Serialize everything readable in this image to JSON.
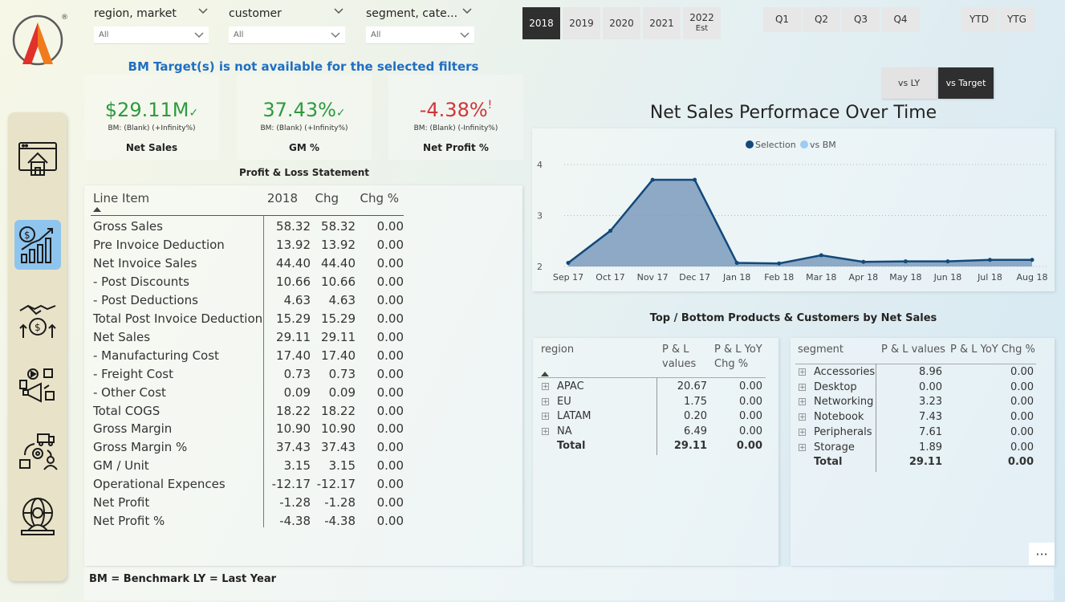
{
  "filters": [
    {
      "label": "region, market",
      "value": "All"
    },
    {
      "label": "customer",
      "value": "All"
    },
    {
      "label": "segment, cate...",
      "value": "All"
    }
  ],
  "years": [
    {
      "label": "2018",
      "active": true
    },
    {
      "label": "2019",
      "active": false
    },
    {
      "label": "2020",
      "active": false
    },
    {
      "label": "2021",
      "active": false
    },
    {
      "label": "2022",
      "sub": "Est",
      "active": false
    }
  ],
  "quarters": [
    "Q1",
    "Q2",
    "Q3",
    "Q4"
  ],
  "period": [
    "YTD",
    "YTG"
  ],
  "compare": [
    {
      "label": "vs LY",
      "active": false
    },
    {
      "label": "vs Target",
      "active": true
    }
  ],
  "banner": "BM Target(s) is not available for the selected filters",
  "kpis": [
    {
      "value": "$29.11M",
      "mark": "✓",
      "bm": "BM: (Blank) (+Infinity%)",
      "label": "Net Sales",
      "color": "#2e9a3f"
    },
    {
      "value": "37.43%",
      "mark": "✓",
      "bm": "BM: (Blank) (+Infinity%)",
      "label": "GM %",
      "color": "#2e9a3f"
    },
    {
      "value": "-4.38%",
      "mark": "!",
      "bm": "BM: (Blank) (-Infinity%)",
      "label": "Net Profit %",
      "color": "#d13438"
    }
  ],
  "pl": {
    "title": "Profit & Loss Statement",
    "headers": [
      "Line Item",
      "2018",
      "Chg",
      "Chg %"
    ],
    "rows": [
      [
        "Gross Sales",
        "58.32",
        "58.32",
        "0.00"
      ],
      [
        "Pre Invoice Deduction",
        "13.92",
        "13.92",
        "0.00"
      ],
      [
        "Net Invoice Sales",
        "44.40",
        "44.40",
        "0.00"
      ],
      [
        " - Post Discounts",
        "10.66",
        "10.66",
        "0.00"
      ],
      [
        " - Post Deductions",
        "4.63",
        "4.63",
        "0.00"
      ],
      [
        "Total Post Invoice Deduction",
        "15.29",
        "15.29",
        "0.00"
      ],
      [
        "Net Sales",
        "29.11",
        "29.11",
        "0.00"
      ],
      [
        " - Manufacturing Cost",
        "17.40",
        "17.40",
        "0.00"
      ],
      [
        " - Freight Cost",
        "0.73",
        "0.73",
        "0.00"
      ],
      [
        " - Other Cost",
        "0.09",
        "0.09",
        "0.00"
      ],
      [
        "Total COGS",
        "18.22",
        "18.22",
        "0.00"
      ],
      [
        "Gross Margin",
        "10.90",
        "10.90",
        "0.00"
      ],
      [
        "Gross Margin %",
        "37.43",
        "37.43",
        "0.00"
      ],
      [
        "GM / Unit",
        "3.15",
        "3.15",
        "0.00"
      ],
      [
        "Operational Expences",
        "-12.17",
        "-12.17",
        "0.00"
      ],
      [
        "Net Profit",
        "-1.28",
        "-1.28",
        "0.00"
      ],
      [
        "Net Profit %",
        "-4.38",
        "-4.38",
        "0.00"
      ]
    ]
  },
  "chart_data": {
    "type": "area",
    "title": "Net Sales Performace Over Time",
    "legend": [
      "Selection",
      "vs BM"
    ],
    "legend_position": "top-center",
    "colors": {
      "selection": "#12497a",
      "bm": "#9ecbf0",
      "fill": "#7b9bbd"
    },
    "categories": [
      "Sep 17",
      "Oct 17",
      "Nov 17",
      "Dec 17",
      "Jan 18",
      "Feb 18",
      "Mar 18",
      "Apr 18",
      "May 18",
      "Jun 18",
      "Jul 18",
      "Aug 18"
    ],
    "yticks": [
      "2",
      "3",
      "4"
    ],
    "ylim": [
      2,
      4
    ],
    "grid": true,
    "series": [
      {
        "name": "Selection",
        "values": [
          2.07,
          2.7,
          3.7,
          3.7,
          2.07,
          2.06,
          2.22,
          2.09,
          2.1,
          2.1,
          2.13,
          2.13
        ]
      }
    ]
  },
  "top_bottom_title": "Top / Bottom Products & Customers by Net Sales",
  "region_matrix": {
    "headers": [
      "region",
      "P & L values",
      "P & L YoY Chg %"
    ],
    "header_lines": [
      [
        "region"
      ],
      [
        "P & L",
        "values"
      ],
      [
        "P & L YoY",
        "Chg %"
      ]
    ],
    "rows": [
      [
        "APAC",
        "20.67",
        "0.00"
      ],
      [
        "EU",
        "1.75",
        "0.00"
      ],
      [
        "LATAM",
        "0.20",
        "0.00"
      ],
      [
        "NA",
        "6.49",
        "0.00"
      ]
    ],
    "total": [
      "Total",
      "29.11",
      "0.00"
    ]
  },
  "segment_matrix": {
    "headers": [
      "segment",
      "P & L values",
      "P & L YoY Chg %"
    ],
    "rows": [
      [
        "Accessories",
        "8.96",
        "0.00"
      ],
      [
        "Desktop",
        "0.00",
        "0.00"
      ],
      [
        "Networking",
        "3.23",
        "0.00"
      ],
      [
        "Notebook",
        "7.43",
        "0.00"
      ],
      [
        "Peripherals",
        "7.61",
        "0.00"
      ],
      [
        "Storage",
        "1.89",
        "0.00"
      ]
    ],
    "total": [
      "Total",
      "29.11",
      "0.00"
    ]
  },
  "footer": "BM = Benchmark LY = Last Year",
  "more_label": "···",
  "icons": {
    "logo": "atliq-logo",
    "nav": [
      "home-icon",
      "finance-icon",
      "sales-icon",
      "marketing-icon",
      "supply-chain-icon",
      "executive-icon"
    ]
  },
  "nav_active_color": "#8ec5ee"
}
